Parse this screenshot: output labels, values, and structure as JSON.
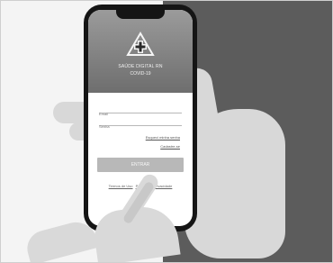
{
  "app": {
    "brand_title": "SAÚDE DIGITAL RN",
    "brand_subtitle": "COVID-19"
  },
  "login_form": {
    "email_placeholder": "Email",
    "password_placeholder": "Senha",
    "forgot_password_link": "Esqueci minha senha",
    "create_account_link": "Cadastre-se",
    "submit_label": "ENTRAR",
    "terms_link": "Termos de Uso",
    "privacy_link": "Política de Privacidade"
  },
  "icons": {
    "logo": "medical-cross-triangle-logo"
  }
}
